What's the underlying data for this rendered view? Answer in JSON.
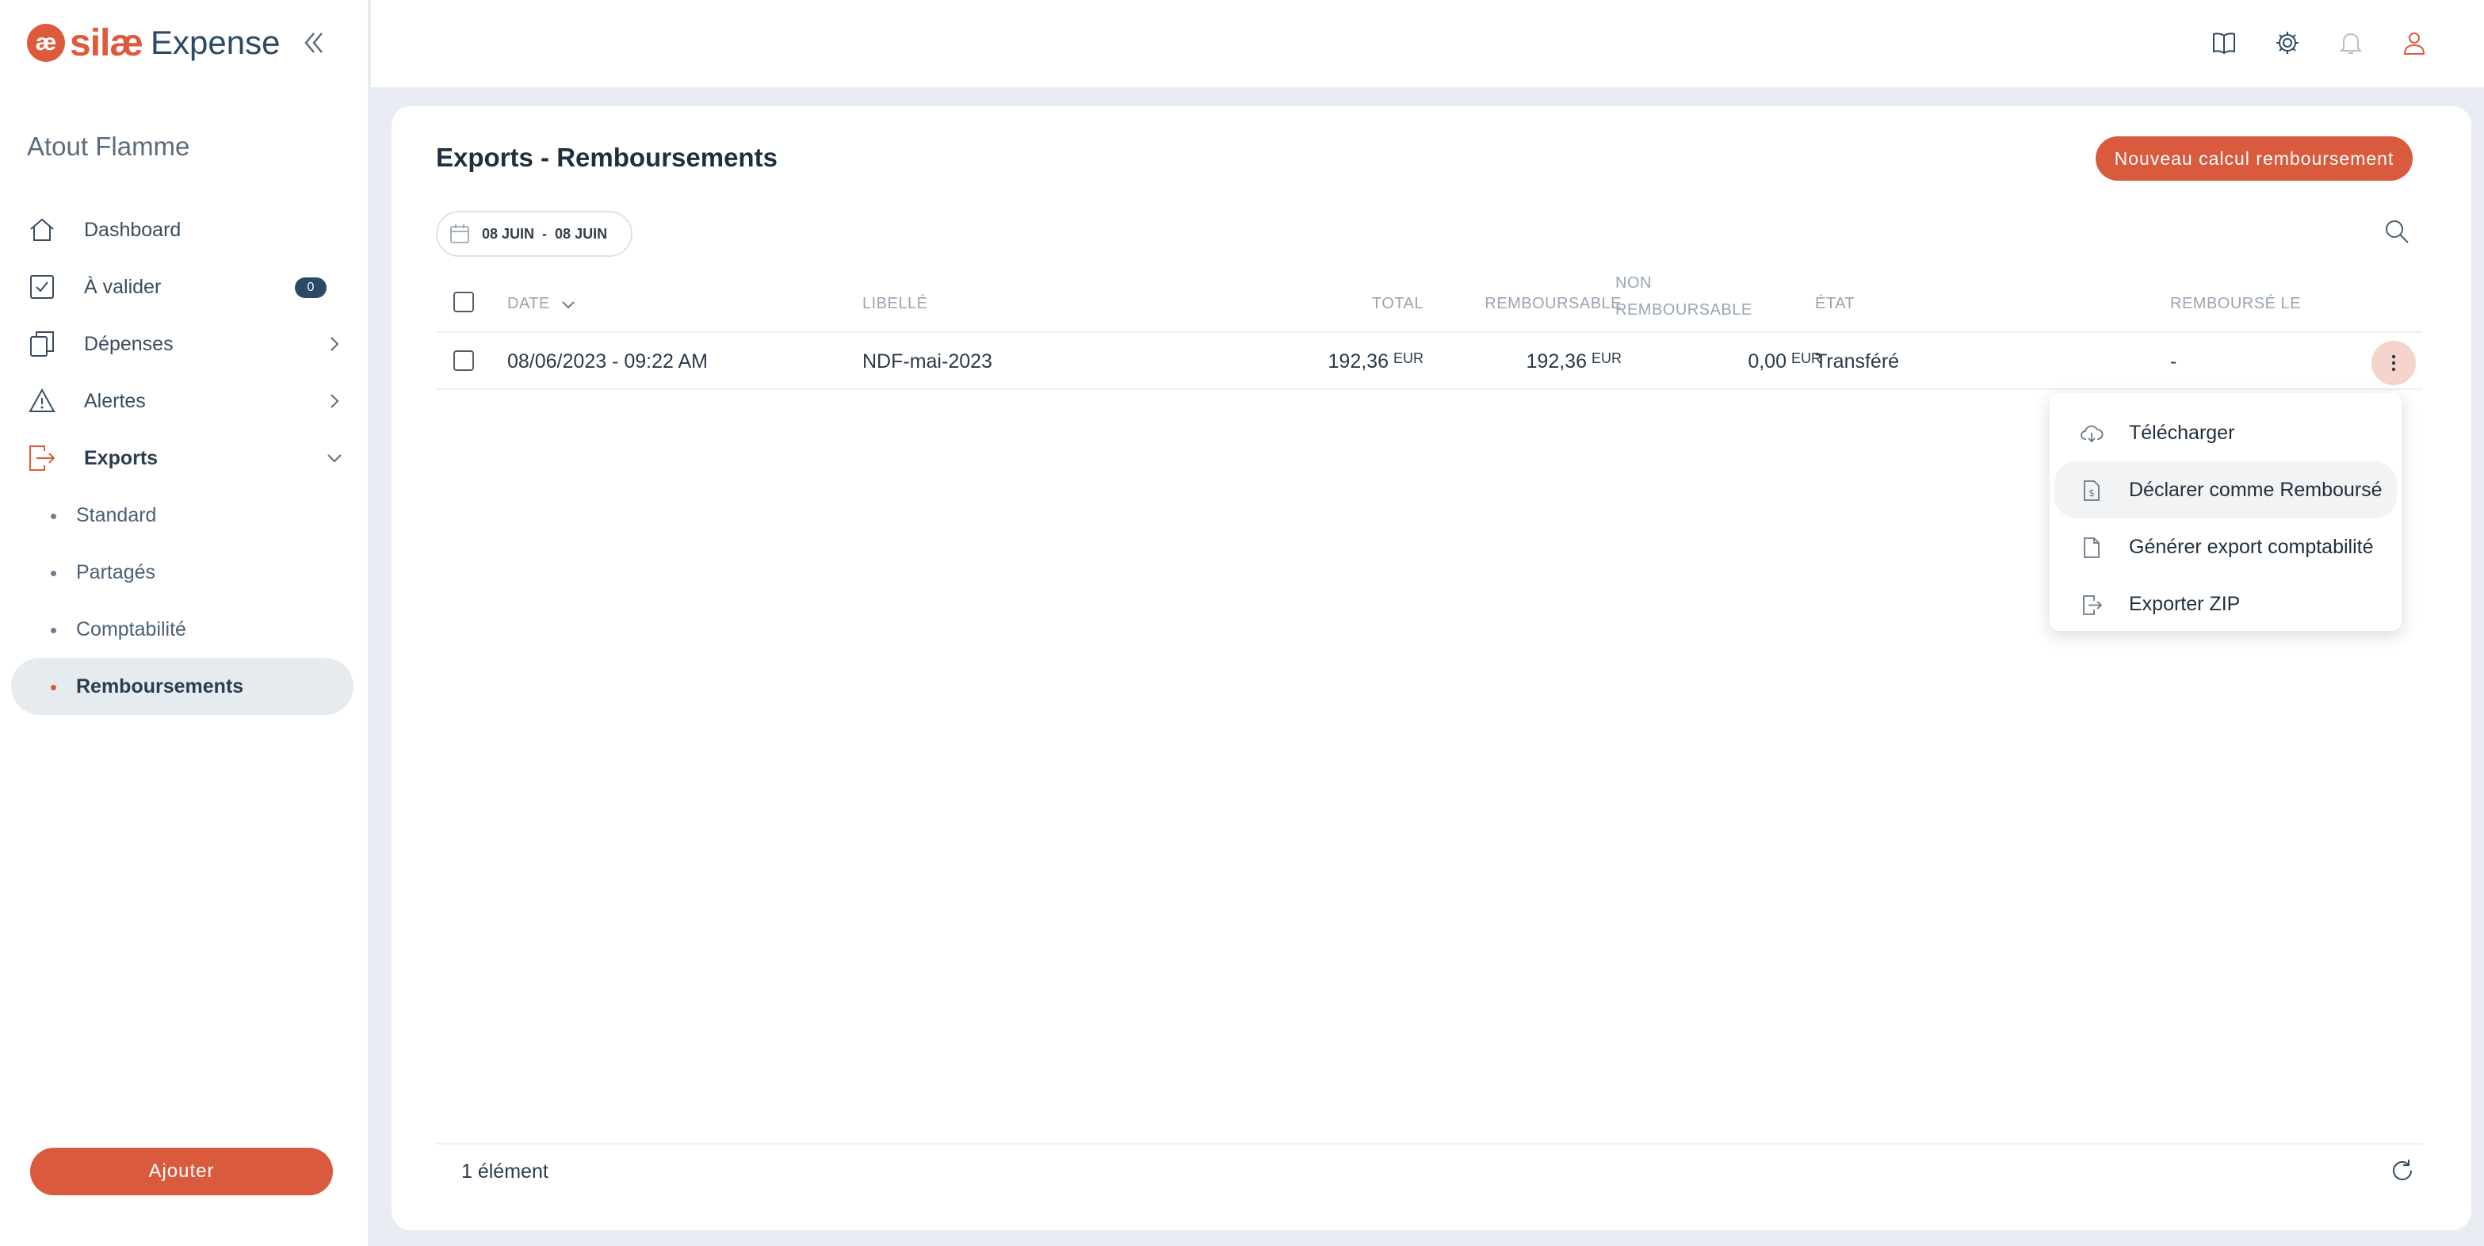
{
  "brand": {
    "silae": "silæ",
    "product": "Expense",
    "mark": "æ"
  },
  "sidebar": {
    "company": "Atout Flamme",
    "items": [
      {
        "label": "Dashboard",
        "icon": "home-icon"
      },
      {
        "label": "À valider",
        "icon": "check-square-icon",
        "badge": "0"
      },
      {
        "label": "Dépenses",
        "icon": "documents-icon"
      },
      {
        "label": "Alertes",
        "icon": "warning-icon"
      },
      {
        "label": "Exports",
        "icon": "export-icon"
      }
    ],
    "sub_items": [
      {
        "label": "Standard"
      },
      {
        "label": "Partagés"
      },
      {
        "label": "Comptabilité"
      },
      {
        "label": "Remboursements"
      }
    ],
    "add_label": "Ajouter"
  },
  "colors": {
    "accent": "#d95a3d",
    "navy": "#2b4a67"
  },
  "main": {
    "title": "Exports - Remboursements",
    "new_button": "Nouveau calcul remboursement",
    "date_from": "08 JUIN",
    "date_sep": "-",
    "date_to": "08 JUIN",
    "table": {
      "headers": {
        "date": "DATE",
        "libelle": "LIBELLÉ",
        "total": "TOTAL",
        "remboursable": "REMBOURSABLE",
        "non_line1": "NON",
        "non_line2": "REMBOURSABLE",
        "etat": "ÉTAT",
        "rembourse_le": "REMBOURSÉ LE"
      },
      "rows": [
        {
          "date": "08/06/2023 - 09:22 AM",
          "libelle": "NDF-mai-2023",
          "total": "192,36",
          "remboursable": "192,36",
          "non_remboursable": "0,00",
          "currency": "EUR",
          "etat": "Transféré",
          "rembourse_le": "-"
        }
      ]
    },
    "footer_count": "1 élément"
  },
  "menu": {
    "items": [
      {
        "label": "Télécharger",
        "icon": "cloud-download-icon"
      },
      {
        "label": "Déclarer comme Remboursé",
        "icon": "file-dollar-icon"
      },
      {
        "label": "Générer export comptabilité",
        "icon": "file-icon"
      },
      {
        "label": "Exporter ZIP",
        "icon": "file-export-icon"
      }
    ]
  }
}
